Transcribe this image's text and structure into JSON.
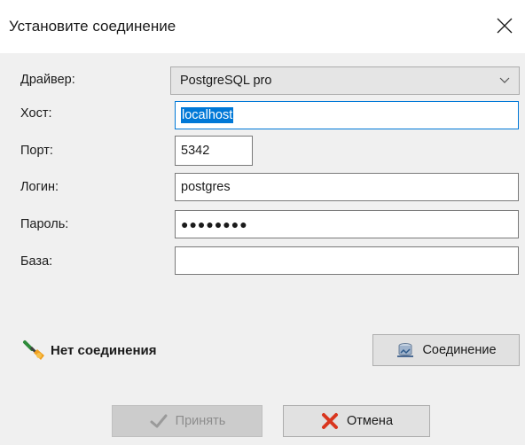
{
  "window": {
    "title": "Установите соединение"
  },
  "form": {
    "driver_label": "Драйвер:",
    "driver_value": "PostgreSQL pro",
    "host_label": "Хост:",
    "host_value": "localhost",
    "port_label": "Порт:",
    "port_value": "5342",
    "login_label": "Логин:",
    "login_value": "postgres",
    "password_label": "Пароль:",
    "password_value": "●●●●●●●●",
    "database_label": "База:",
    "database_value": ""
  },
  "status": {
    "text": "Нет соединения",
    "icon": "plug-icon"
  },
  "buttons": {
    "connect_label": "Соединение",
    "accept_label": "Принять",
    "cancel_label": "Отмена"
  },
  "colors": {
    "focus_border": "#0078d7",
    "selection_bg": "#0078d7",
    "cancel_icon": "#d9361f"
  }
}
